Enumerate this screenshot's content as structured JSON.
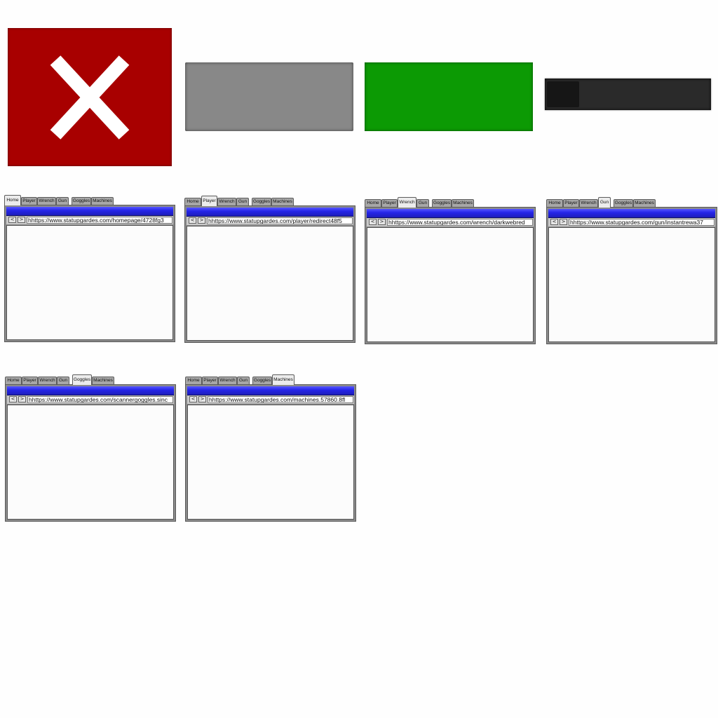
{
  "assets": {
    "close_icon": "close-icon",
    "close_color": "#a80000",
    "gray_color": "#888888",
    "green_color": "#0c9a04",
    "dark_color": "#2a2a2a",
    "dark_bar_progress": 0.2
  },
  "tab_labels": [
    "Home",
    "Player",
    "Wrench",
    "Gun",
    "Goggles",
    "Machines"
  ],
  "browsers": [
    {
      "active_tab": "Home",
      "url": "hhttps://www.statupgardes.com/homepage/4728fg3"
    },
    {
      "active_tab": "Player",
      "url": "hhttps://www.statupgardes.com/player/redirect48f5"
    },
    {
      "active_tab": "Wrench",
      "url": "hhttps://www.statupgardes.com/wrench/darkwebred"
    },
    {
      "active_tab": "Gun",
      "url": "hhttps://www.statupgardes.com/gun/instantrewa37"
    },
    {
      "active_tab": "Goggles",
      "url": "hhttps://www.statupgardes.com/scannergoggles.sinc"
    },
    {
      "active_tab": "Machines",
      "url": "hhttps://www.statupgardes.com/machines.57860.8fl"
    }
  ],
  "nav": {
    "back": "<",
    "forward": ">"
  },
  "colors": {
    "title_bar": "#2525e8",
    "content_bg": "#fcfcfc"
  }
}
